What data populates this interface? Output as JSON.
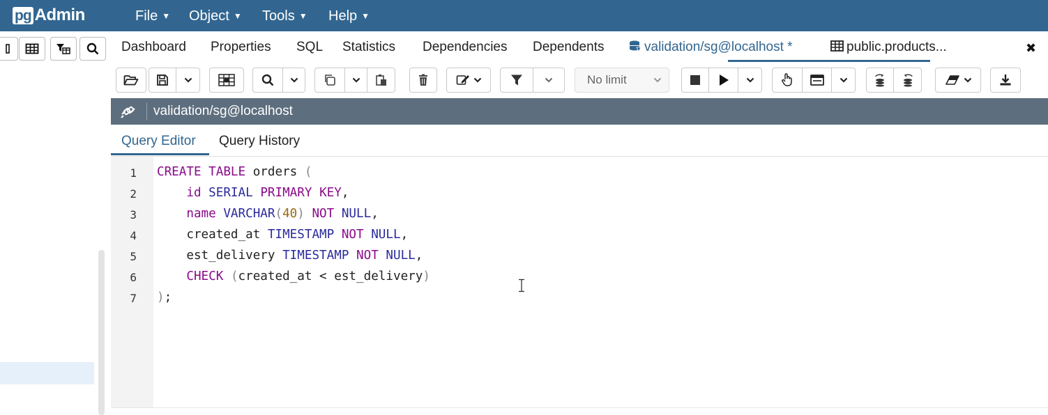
{
  "app": {
    "logo_prefix": "pg",
    "logo_suffix": "Admin"
  },
  "menu": {
    "items": [
      {
        "label": "File",
        "icon": "chevron-down-icon"
      },
      {
        "label": "Object",
        "icon": "chevron-down-icon"
      },
      {
        "label": "Tools",
        "icon": "chevron-down-icon"
      },
      {
        "label": "Help",
        "icon": "chevron-down-icon"
      }
    ]
  },
  "main_tabs": {
    "items": [
      {
        "label": "Dashboard"
      },
      {
        "label": "Properties"
      },
      {
        "label": "SQL"
      },
      {
        "label": "Statistics"
      },
      {
        "label": "Dependencies"
      },
      {
        "label": "Dependents"
      },
      {
        "label": "validation/sg@localhost *",
        "icon": "database-icon",
        "active": true
      },
      {
        "label": "public.products...",
        "icon": "table-icon"
      }
    ],
    "close_label": "✖"
  },
  "toolbar": {
    "limit_value": "No limit"
  },
  "connection": {
    "label": "validation/sg@localhost"
  },
  "editor_tabs": {
    "items": [
      {
        "label": "Query Editor",
        "active": true
      },
      {
        "label": "Query History"
      }
    ]
  },
  "editor": {
    "line_numbers": [
      "1",
      "2",
      "3",
      "4",
      "5",
      "6",
      "7"
    ],
    "lines": [
      "CREATE TABLE orders (",
      "    id SERIAL PRIMARY KEY,",
      "    name VARCHAR(40) NOT NULL,",
      "    created_at TIMESTAMP NOT NULL,",
      "    est_delivery TIMESTAMP NOT NULL,",
      "    CHECK (created_at < est_delivery)",
      ");"
    ]
  },
  "colors": {
    "header_bg": "#326690",
    "connection_bar_bg": "#5d6e7e",
    "keyword": "#8a0a8a",
    "type": "#2a2a9c",
    "number": "#9a6a10"
  }
}
